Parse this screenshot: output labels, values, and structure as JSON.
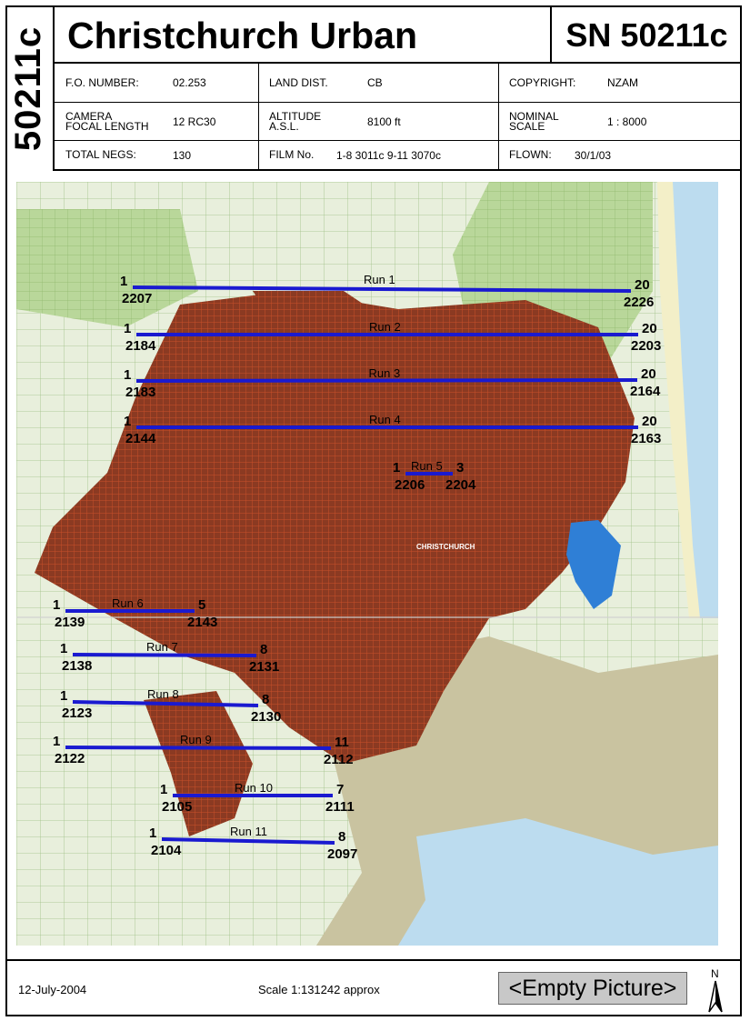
{
  "sheet": {
    "vertical_code": "50211c",
    "title": "Christchurch Urban",
    "survey_number": "SN 50211c"
  },
  "info": {
    "fo_number_label": "F.O. NUMBER:",
    "fo_number": "02.253",
    "land_dist_label": "LAND DIST.",
    "land_dist": "CB",
    "copyright_label": "COPYRIGHT:",
    "copyright": "NZAM",
    "camera_label_1": "CAMERA",
    "camera_label_2": "FOCAL LENGTH",
    "camera": "12 RC30",
    "altitude_label_1": "ALTITUDE",
    "altitude_label_2": "A.S.L.",
    "altitude": "8100 ft",
    "scale_label_1": "NOMINAL",
    "scale_label_2": "SCALE",
    "nominal_scale": "1 : 8000",
    "total_negs_label": "TOTAL NEGS:",
    "total_negs": "130",
    "film_label": "FILM No.",
    "film": "1-8 3011c  9-11 3070c",
    "flown_label": "FLOWN:",
    "flown": "30/1/03"
  },
  "map": {
    "city_label": "CHRISTCHURCH",
    "colors": {
      "run_line": "#1a1ad0",
      "urban": "#8b3a22",
      "urban_grid": "#c8502a",
      "farmland": "#e8efdc",
      "farmland_green": "#b9d79a",
      "hills": "#c9c3a0",
      "sea": "#bcdcef",
      "estuary": "#2f7fd6"
    },
    "runs": [
      {
        "label": "Run 1",
        "start_frame": "1",
        "start_neg": "2207",
        "end_frame": "20",
        "end_neg": "2226"
      },
      {
        "label": "Run 2",
        "start_frame": "1",
        "start_neg": "2184",
        "end_frame": "20",
        "end_neg": "2203"
      },
      {
        "label": "Run 3",
        "start_frame": "1",
        "start_neg": "2183",
        "end_frame": "20",
        "end_neg": "2164"
      },
      {
        "label": "Run 4",
        "start_frame": "1",
        "start_neg": "2144",
        "end_frame": "20",
        "end_neg": "2163"
      },
      {
        "label": "Run 5",
        "start_frame": "1",
        "start_neg": "2206",
        "end_frame": "3",
        "end_neg": "2204"
      },
      {
        "label": "Run 6",
        "start_frame": "1",
        "start_neg": "2139",
        "end_frame": "5",
        "end_neg": "2143"
      },
      {
        "label": "Run 7",
        "start_frame": "1",
        "start_neg": "2138",
        "end_frame": "8",
        "end_neg": "2131"
      },
      {
        "label": "Run 8",
        "start_frame": "1",
        "start_neg": "2123",
        "end_frame": "8",
        "end_neg": "2130"
      },
      {
        "label": "Run 9",
        "start_frame": "1",
        "start_neg": "2122",
        "end_frame": "11",
        "end_neg": "2112"
      },
      {
        "label": "Run 10",
        "start_frame": "1",
        "start_neg": "2105",
        "end_frame": "7",
        "end_neg": "2111"
      },
      {
        "label": "Run 11",
        "start_frame": "1",
        "start_neg": "2104",
        "end_frame": "8",
        "end_neg": "2097"
      }
    ]
  },
  "footer": {
    "date": "12-July-2004",
    "scale": "Scale  1:131242 approx",
    "empty_picture": "<Empty Picture>",
    "north_label": "N",
    "north_icon": "north-arrow-icon"
  }
}
